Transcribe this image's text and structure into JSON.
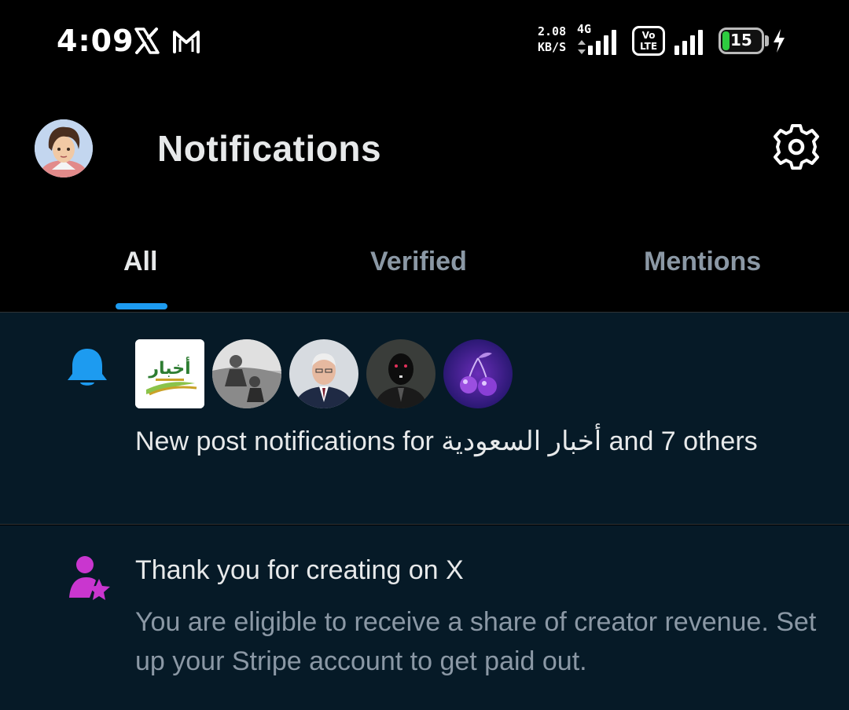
{
  "status_bar": {
    "time": "4:09",
    "notification_icons": [
      "x-logo-icon",
      "gmail-icon"
    ],
    "net_speed_value": "2.08",
    "net_speed_unit": "KB/S",
    "network_type": "4G",
    "volte_top": "Vo",
    "volte_bottom": "LTE",
    "battery_level": "15",
    "charging": true
  },
  "header": {
    "title": "Notifications",
    "settings_icon": "gear-icon"
  },
  "tabs": [
    {
      "label": "All",
      "active": true
    },
    {
      "label": "Verified",
      "active": false
    },
    {
      "label": "Mentions",
      "active": false
    }
  ],
  "notifications": [
    {
      "icon": "bell-icon",
      "avatar_logo_text": "أخبار",
      "text": "New post notifications for أخبار السعودية and 7 others"
    },
    {
      "icon": "creator-star-icon",
      "title": "Thank you for creating on X",
      "body": "You are eligible to receive a share of creator revenue. Set up your Stripe account to get paid out."
    }
  ],
  "colors": {
    "accent": "#1d9bf0",
    "background": "#000000",
    "notification_bg": "#061a27",
    "creator_icon": "#c936cf",
    "secondary_text": "#8b98a5"
  }
}
